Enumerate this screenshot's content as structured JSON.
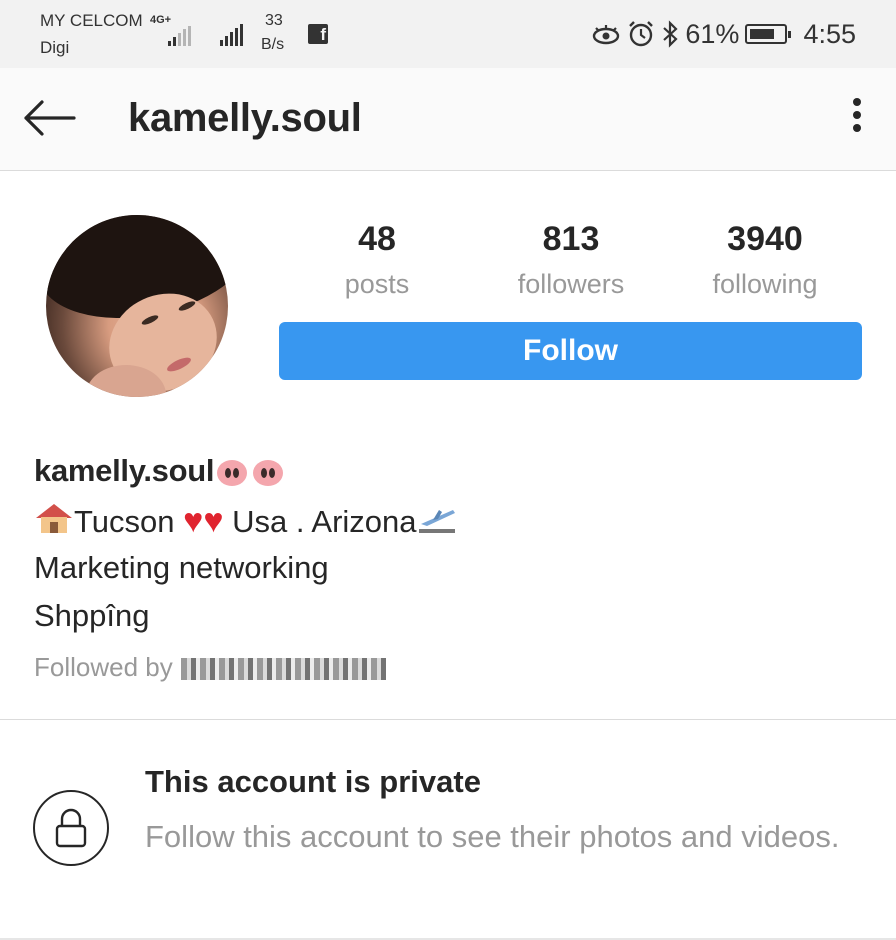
{
  "status_bar": {
    "carrier_primary": "MY CELCOM",
    "carrier_secondary": "Digi",
    "network_type": "4G+",
    "speed_value": "33",
    "speed_unit": "B/s",
    "battery_level": 0.61,
    "battery_percent": "61%",
    "time": "4:55"
  },
  "app_bar": {
    "title": "kamelly.soul"
  },
  "profile": {
    "stats": [
      {
        "value": "48",
        "label": "posts"
      },
      {
        "value": "813",
        "label": "followers"
      },
      {
        "value": "3940",
        "label": "following"
      }
    ],
    "follow_label": "Follow",
    "follow_color": "#3897f0",
    "bio": {
      "name": "kamelly.soul",
      "line1_city": "Tucson",
      "line1_location": "Usa . Arizona",
      "line2": "Marketing networking",
      "line3": "Shppîng"
    },
    "followed_by_label": "Followed by"
  },
  "private_notice": {
    "title": "This account is private",
    "description": "Follow this account to see their photos and videos."
  }
}
